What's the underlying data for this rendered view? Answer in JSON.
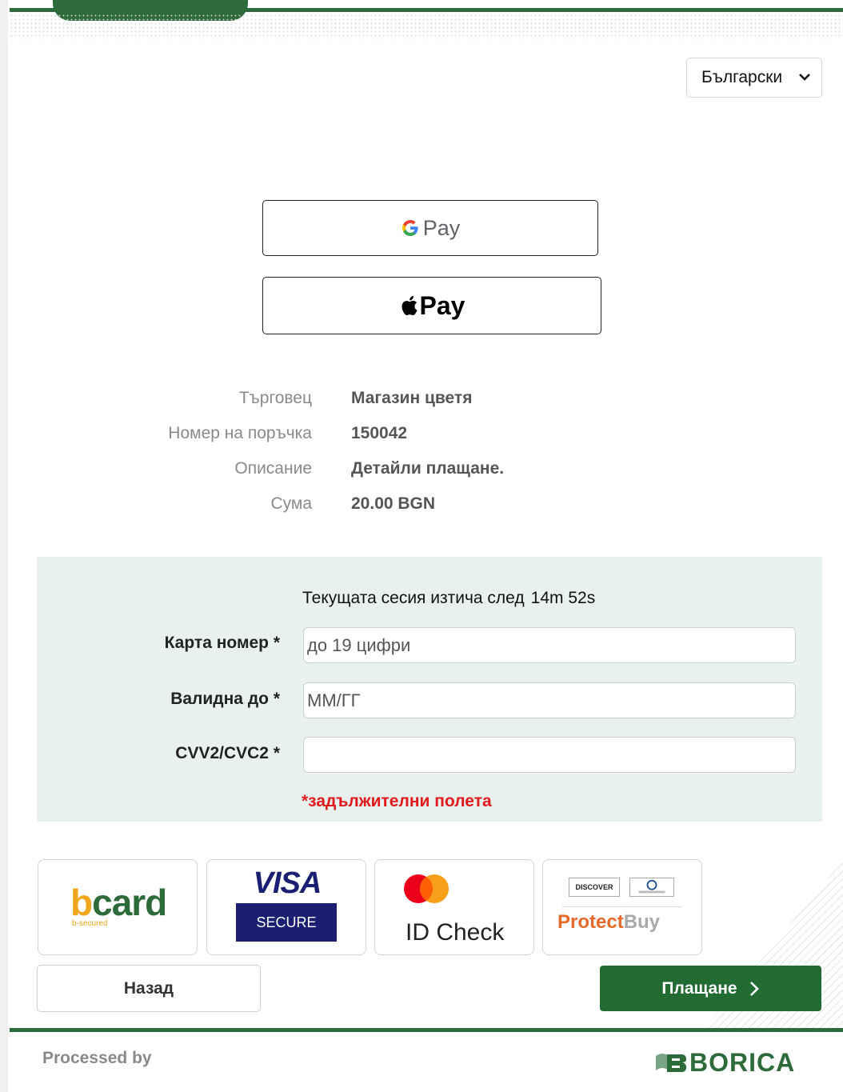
{
  "language_selector": {
    "value": "Български"
  },
  "wallets": {
    "google_pay_label": "Pay",
    "apple_pay_label": "Pay"
  },
  "order_info": [
    {
      "label": "Търговец",
      "value": "Магазин цветя"
    },
    {
      "label": "Номер на поръчка",
      "value": "150042"
    },
    {
      "label": "Описание",
      "value": "Детайли плащане."
    },
    {
      "label": "Сума",
      "value": "20.00 BGN"
    }
  ],
  "session": {
    "text": "Текущата сесия изтича след",
    "timer": "14m 52s"
  },
  "form": {
    "card_number": {
      "label": "Карта номер *",
      "placeholder": "до 19 цифри",
      "value": ""
    },
    "expiry": {
      "label": "Валидна до *",
      "placeholder": "ММ/ГГ",
      "value": ""
    },
    "cvv": {
      "label": "CVV2/CVC2 *",
      "placeholder": "",
      "value": ""
    },
    "required_note": "*задължителни полета"
  },
  "badges": {
    "bcard": {
      "first": "b",
      "rest": "card",
      "sub": "b-secured"
    },
    "visa": {
      "word": "VISA",
      "sub": "SECURE"
    },
    "mastercard": {
      "text": "ID Check"
    },
    "protectbuy": {
      "discover": "DISCOVER",
      "part1": "Protect",
      "part2": "Buy"
    }
  },
  "buttons": {
    "back": "Назад",
    "pay": "Плащане"
  },
  "footer": {
    "processed_by": "Processed by",
    "brand": "BORICA"
  },
  "colors": {
    "brand_green": "#2e6b3b",
    "pay_button": "#226b32",
    "panel_bg": "#e8f1ec",
    "required_red": "#e0191f"
  }
}
